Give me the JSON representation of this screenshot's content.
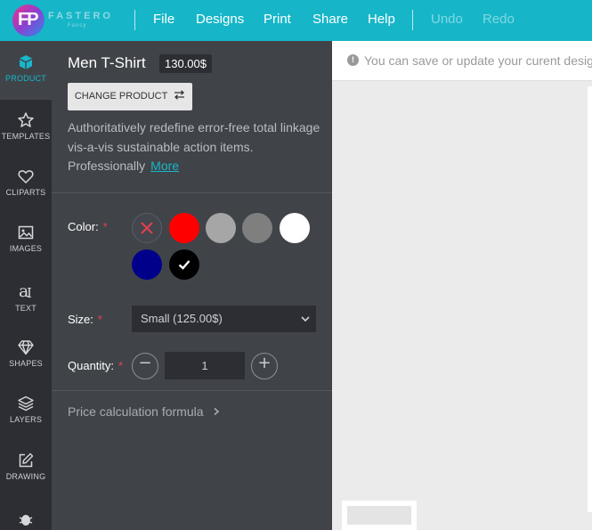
{
  "brand": {
    "name": "FASTERO",
    "letters": "FP",
    "sub": "Fancy"
  },
  "menu": [
    {
      "label": "File",
      "enabled": true
    },
    {
      "label": "Designs",
      "enabled": true
    },
    {
      "label": "Print",
      "enabled": true
    },
    {
      "label": "Share",
      "enabled": true
    },
    {
      "label": "Help",
      "enabled": true
    },
    {
      "label": "Undo",
      "enabled": false
    },
    {
      "label": "Redo",
      "enabled": false
    }
  ],
  "rail": [
    {
      "label": "PRODUCT",
      "icon": "cube-icon",
      "active": true
    },
    {
      "label": "TEMPLATES",
      "icon": "star-icon",
      "active": false
    },
    {
      "label": "CLIPARTS",
      "icon": "heart-icon",
      "active": false
    },
    {
      "label": "IMAGES",
      "icon": "image-icon",
      "active": false
    },
    {
      "label": "TEXT",
      "icon": "text-icon",
      "active": false
    },
    {
      "label": "SHAPES",
      "icon": "diamond-icon",
      "active": false
    },
    {
      "label": "LAYERS",
      "icon": "layers-icon",
      "active": false
    },
    {
      "label": "DRAWING",
      "icon": "edit-icon",
      "active": false
    },
    {
      "label": "",
      "icon": "bug-icon",
      "active": false
    }
  ],
  "product": {
    "title": "Men T-Shirt",
    "price": "130.00$",
    "change_label": "CHANGE PRODUCT",
    "description": "Authoritatively redefine error-free total linkage vis-a-vis sustainable action items. Professionally",
    "more_label": "More"
  },
  "options": {
    "color_label": "Color:",
    "size_label": "Size:",
    "quantity_label": "Quantity:",
    "required_mark": "*",
    "colors": [
      {
        "name": "none",
        "hex": "#43464d",
        "selected": false
      },
      {
        "name": "red",
        "hex": "#ff0000",
        "selected": false
      },
      {
        "name": "light-gray",
        "hex": "#a6a6a6",
        "selected": false
      },
      {
        "name": "gray",
        "hex": "#7f7f7f",
        "selected": false
      },
      {
        "name": "white",
        "hex": "#ffffff",
        "selected": false
      },
      {
        "name": "navy",
        "hex": "#00008b",
        "selected": false
      },
      {
        "name": "black",
        "hex": "#000000",
        "selected": true
      }
    ],
    "size_value": "Small (125.00$)",
    "quantity_value": "1"
  },
  "formula_label": "Price calculation formula",
  "notice": {
    "icon": "!",
    "text": "You can save or update your curent design"
  },
  "colors": {
    "accent": "#16b6c8",
    "panel": "#404449",
    "rail": "#2c2e33",
    "required": "#e5404f"
  }
}
